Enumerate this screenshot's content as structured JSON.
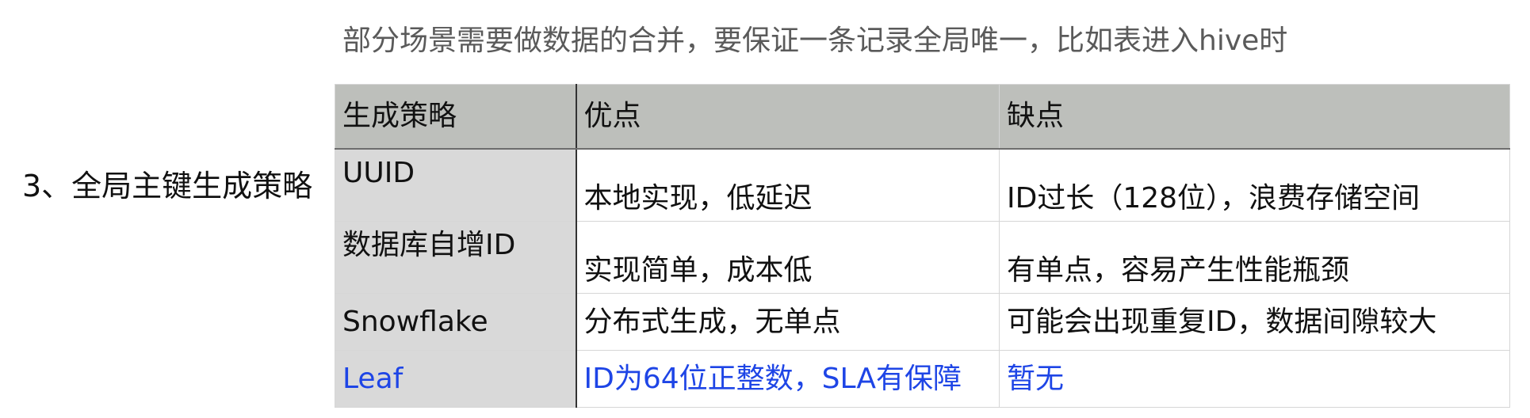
{
  "intro_text": "部分场景需要做数据的合并，要保证一条记录全局唯一，比如表进入hive时",
  "section_label": "3、全局主键生成策略",
  "table": {
    "headers": [
      "生成策略",
      "优点",
      "缺点"
    ],
    "rows": [
      [
        "UUID",
        "本地实现，低延迟",
        "ID过长（128位），浪费存储空间"
      ],
      [
        "数据库自增ID",
        "实现简单，成本低",
        "有单点，容易产生性能瓶颈"
      ],
      [
        "Snowflake",
        "分布式生成，无单点",
        "可能会出现重复ID，数据间隙较大"
      ],
      [
        "Leaf",
        "ID为64位正整数，SLA有保障",
        "暂无"
      ]
    ]
  },
  "colors": {
    "header_bg": "#bdbfbb",
    "first_col_bg": "#d9d9d9",
    "highlight_text": "#1e45e6",
    "intro_text": "#5a5a5a"
  }
}
